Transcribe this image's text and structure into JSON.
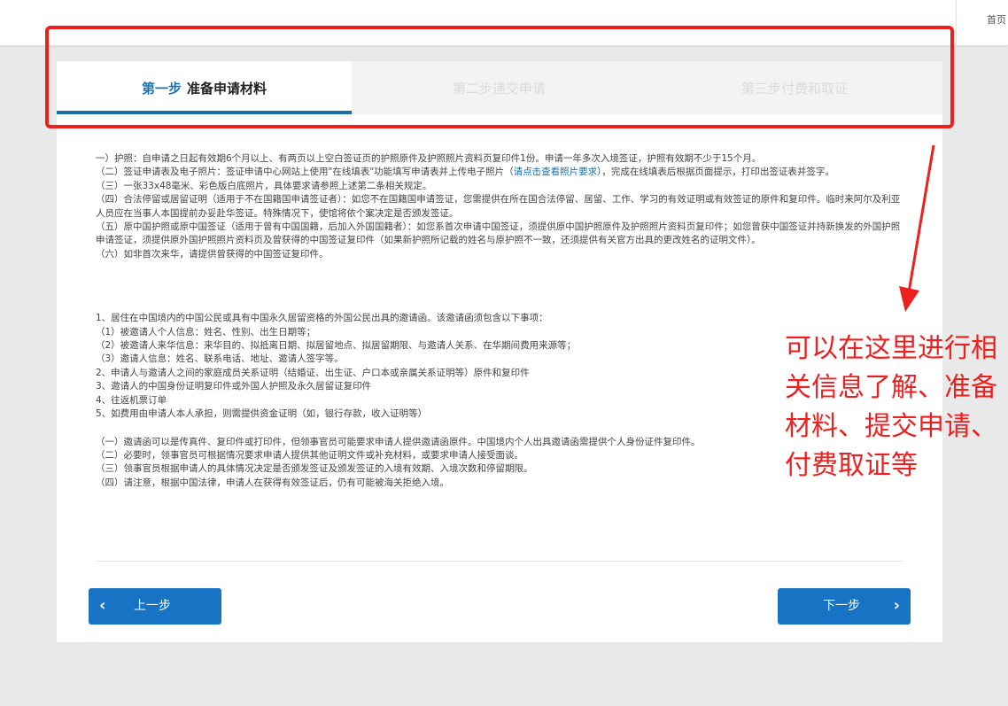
{
  "topbar": {
    "home_label": "首页"
  },
  "steps": [
    {
      "number": "第一步",
      "label": "准备申请材料",
      "active": true
    },
    {
      "label": "第二步递交申请",
      "active": false
    },
    {
      "label": "第三步付费和取证",
      "active": false
    }
  ],
  "section1": [
    "一）护照：自申请之日起有效期6个月以上、有两页以上空白签证页的护照原件及护照照片资料页复印件1份。申请一年多次入境签证，护照有效期不少于15个月。",
    "（二）签证申请表及电子照片：签证申请中心网站上使用\"在线填表\"功能填写申请表并上传电子照片（",
    "（三）一张33x48毫米、彩色版白底照片，具体要求请参照上述第二条相关规定。",
    "（四）合法停留或居留证明（适用于不在国籍国申请签证者）：如您不在国籍国申请签证，您需提供在所在国合法停留、居留、工作、学习的有效证明或有效签证的原件和复印件。临时来阿尔及利亚人员应在当事人本国提前办妥赴华签证。特殊情况下，使馆将依个案决定是否颁发签证。",
    "（五）原中国护照或原中国签证（适用于曾有中国国籍，后加入外国国籍者）：如您系首次申请中国签证，须提供原中国护照原件及护照照片资料页复印件；如您曾获中国签证并持新换发的外国护照申请签证，须提供原外国护照照片资料页及曾获得的中国签证复印件（如果新护照所记载的姓名与原护照不一致，还须提供有关官方出具的更改姓名的证明文件）。",
    "（六）如非首次来华，请提供曾获得的中国签证复印件。"
  ],
  "section1_link": "请点击查看照片要求",
  "section1_after_link": "），完成在线填表后根据页面提示，打印出签证表并签字。",
  "section2": [
    "1、居住在中国境内的中国公民或具有中国永久居留资格的外国公民出具的邀请函。该邀请函须包含以下事项：",
    "（1）被邀请人个人信息：姓名、性别、出生日期等；",
    "（2）被邀请人来华信息：来华目的、拟抵离日期、拟居留地点、拟居留期限、与邀请人关系、在华期间费用来源等；",
    "（3）邀请人信息：姓名、联系电话、地址、邀请人签字等。",
    "2、申请人与邀请人之间的家庭成员关系证明（结婚证、出生证、户口本或亲属关系证明等）原件和复印件",
    "3、邀请人的中国身份证明复印件或外国人护照及永久居留证复印件",
    "4、往返机票订单",
    "5、如费用由申请人本人承担，则需提供资金证明（如，银行存款，收入证明等）"
  ],
  "section3": [
    "（一）邀请函可以是传真件、复印件或打印件，但领事官员可能要求申请人提供邀请函原件。中国境内个人出具邀请函需提供个人身份证件复印件。",
    "（二）必要时，领事官员可根据情况要求申请人提供其他证明文件或补充材料，或要求申请人接受面谈。",
    "（三）领事官员根据申请人的具体情况决定是否颁发签证及颁发签证的入境有效期、入境次数和停留期限。",
    "（四）请注意，根据中国法律，申请人在获得有效签证后，仍有可能被海关拒绝入境。"
  ],
  "buttons": {
    "prev_label": "上一步",
    "next_label": "下一步"
  },
  "annotation": "可以在这里进行相关信息了解、准备材料、提交申请、付费取证等",
  "colors": {
    "accent": "#1773c3",
    "annotation": "#ee1f1f",
    "underline": "#1b6fa8"
  }
}
